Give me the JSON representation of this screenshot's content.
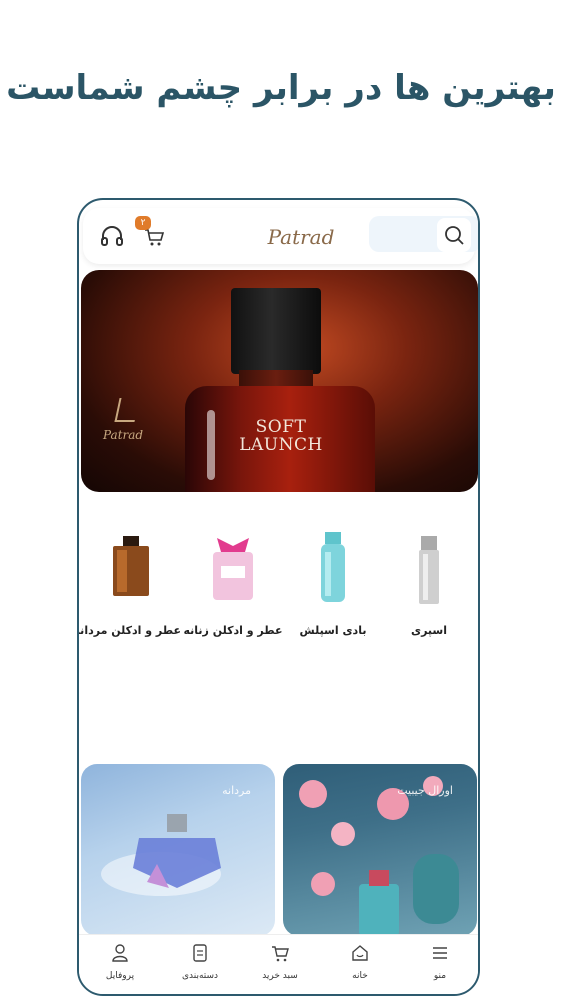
{
  "headline": "بهترین ها در برابر چشم شماست",
  "header": {
    "logo_text": "Patrad",
    "cart_badge": "۲"
  },
  "hero": {
    "title_line1": "SOFT",
    "title_line2": "LAUNCH",
    "logo_text": "Patrad"
  },
  "categories": [
    {
      "label": "عطر و ادکلن مردانه",
      "icon": "perfume-amber-bottle"
    },
    {
      "label": "عطر و ادکلن زنانه",
      "icon": "perfume-pink-bow-bottle"
    },
    {
      "label": "بادی اسپلش",
      "icon": "body-splash-bottle"
    },
    {
      "label": "اسپری",
      "icon": "spray-can"
    }
  ],
  "promos": [
    {
      "label": "مردانه"
    },
    {
      "label": "اورال جیبیت"
    }
  ],
  "bottom_nav": [
    {
      "label": "پروفایل",
      "icon": "user-icon"
    },
    {
      "label": "دسته‌بندی",
      "icon": "category-icon"
    },
    {
      "label": "سبد خرید",
      "icon": "cart-icon"
    },
    {
      "label": "خانه",
      "icon": "home-icon"
    },
    {
      "label": "منو",
      "icon": "menu-icon"
    }
  ],
  "colors": {
    "accent": "#2d5a6e",
    "badge": "#e07b2a"
  }
}
